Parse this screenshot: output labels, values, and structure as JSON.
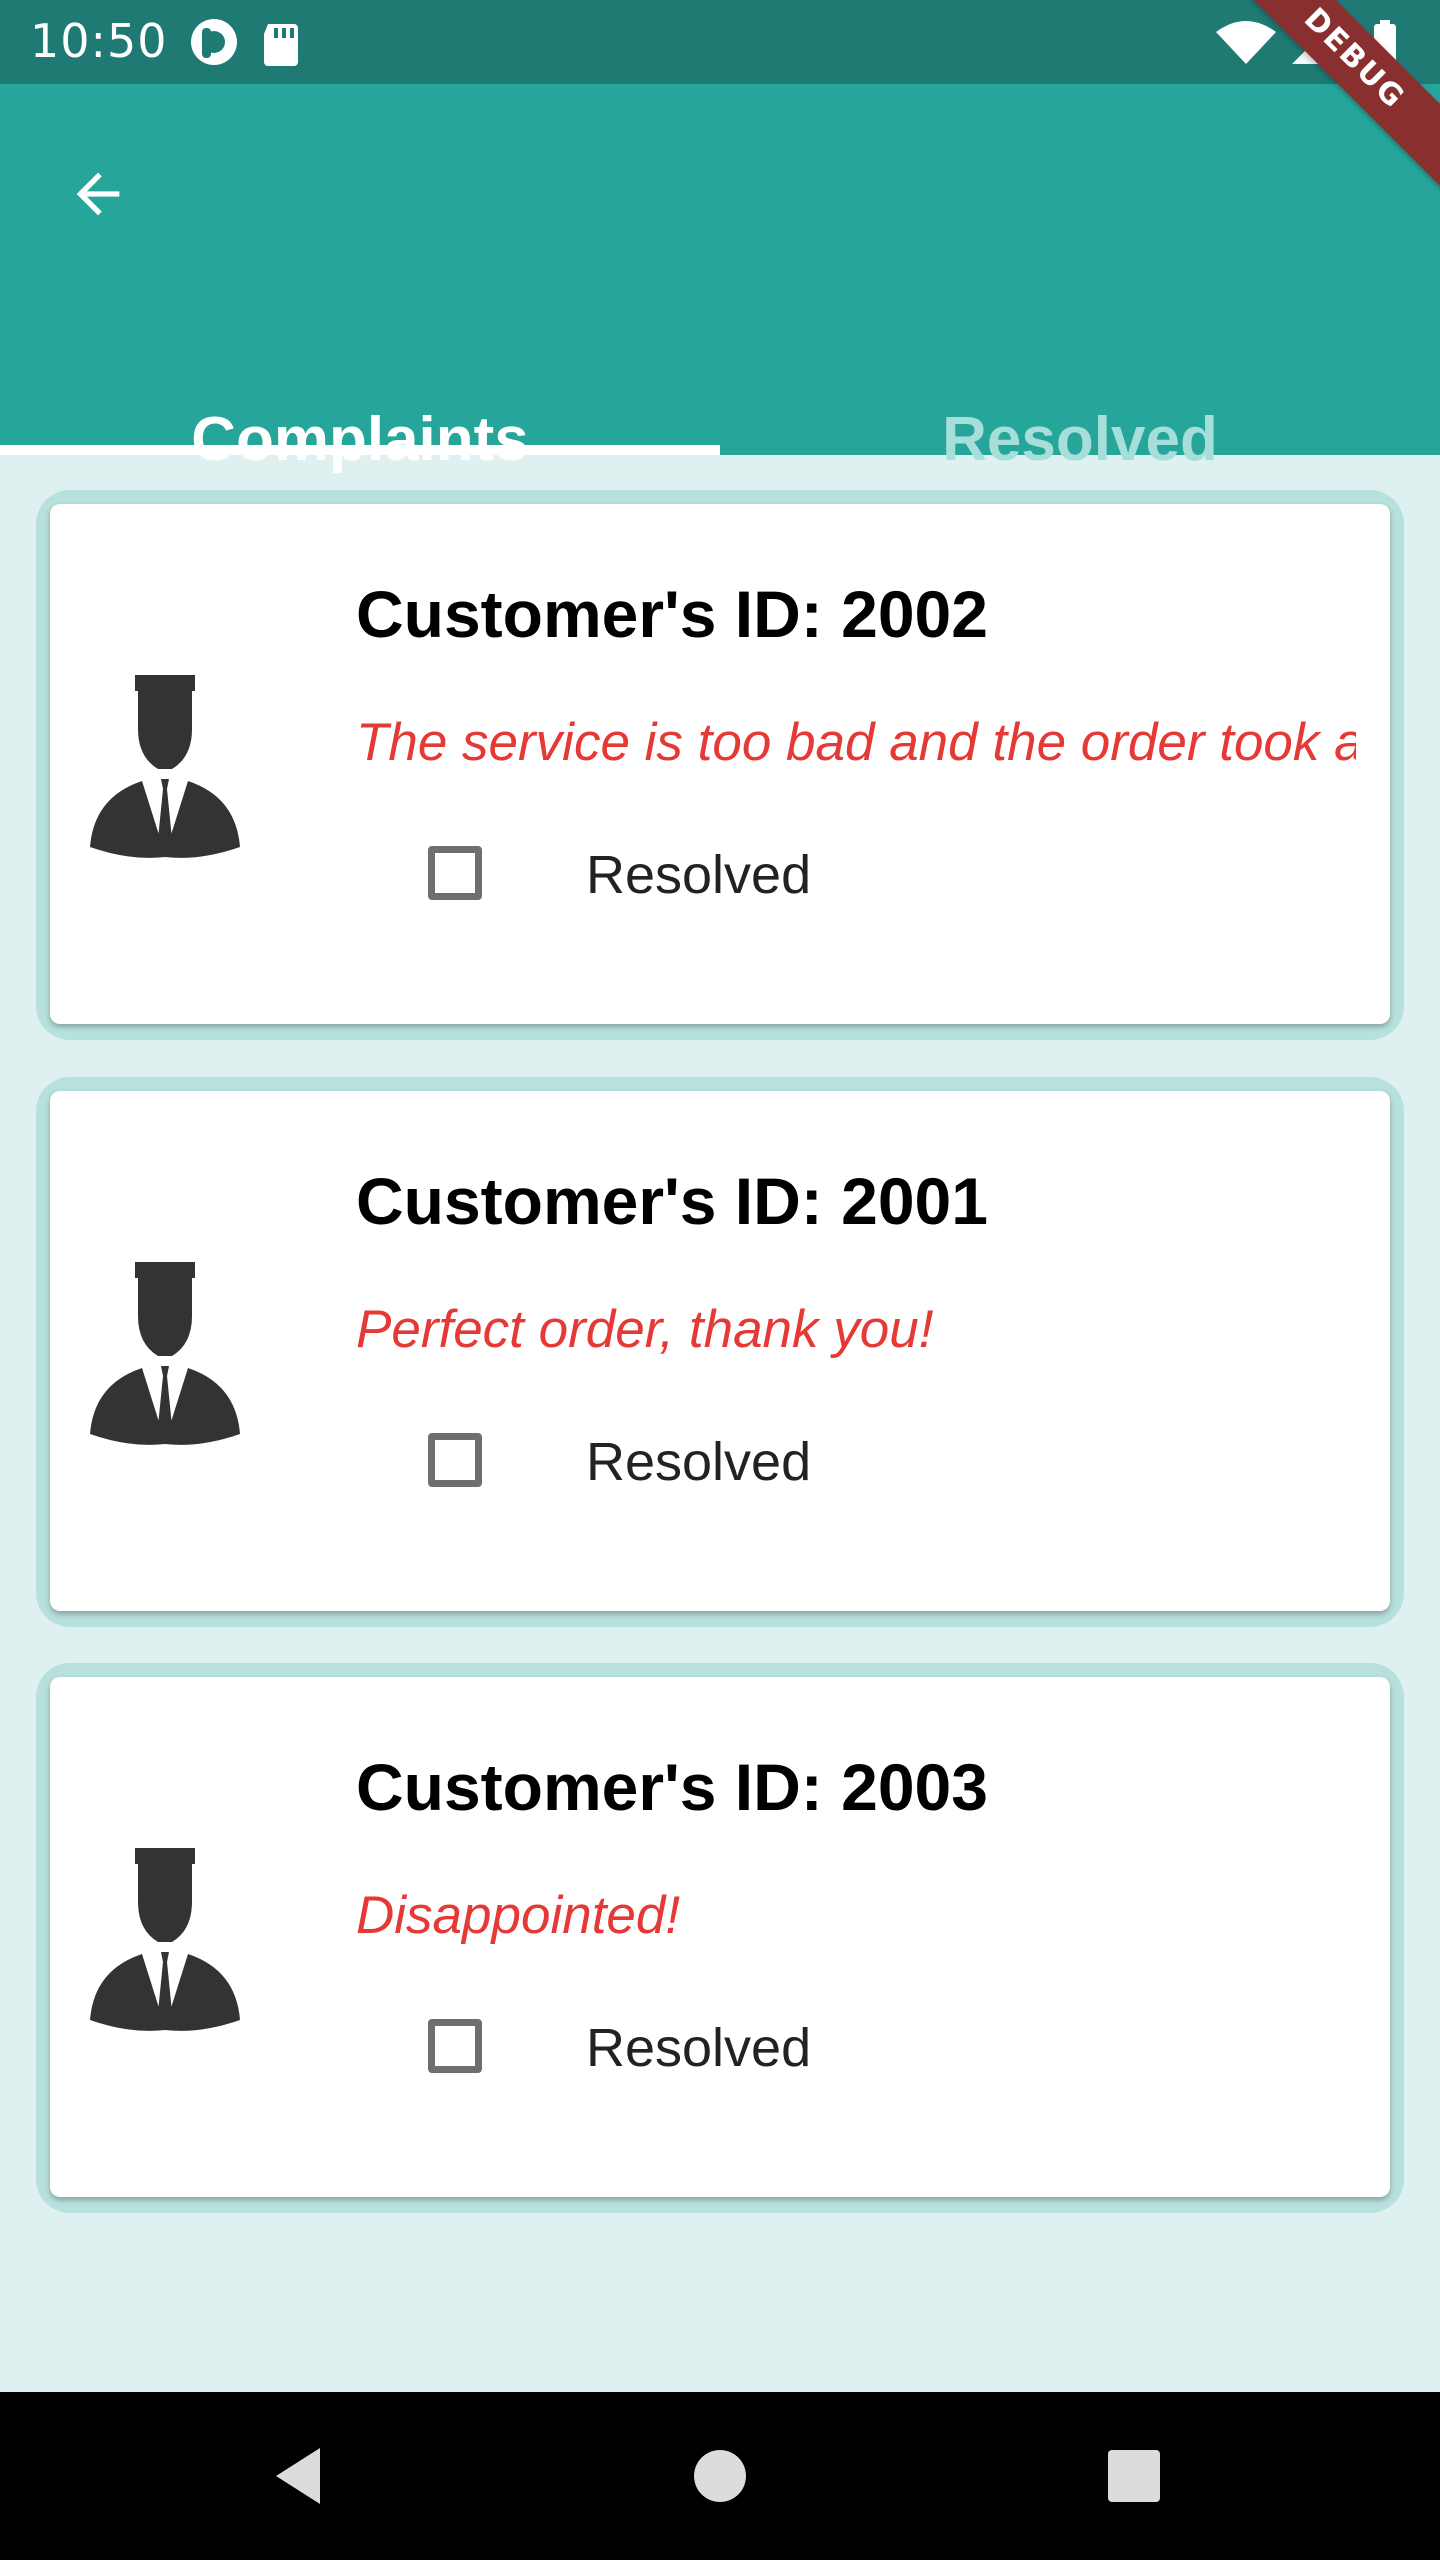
{
  "status_bar": {
    "time": "10:50",
    "icons": [
      "pocket-casts-icon",
      "sd-card-icon",
      "wifi-icon",
      "signal-icon",
      "battery-icon"
    ]
  },
  "debug_banner": {
    "label": "DEBUG"
  },
  "tabs": [
    {
      "label": "Complaints",
      "selected": true
    },
    {
      "label": "Resolved",
      "selected": false
    }
  ],
  "complaints": [
    {
      "customer_id": "Customer's ID: 2002",
      "message": "The service is too bad and the order took a",
      "checkbox_label": "Resolved",
      "checked": false
    },
    {
      "customer_id": "Customer's ID: 2001",
      "message": "Perfect order, thank you!",
      "checkbox_label": "Resolved",
      "checked": false
    },
    {
      "customer_id": "Customer's ID: 2003",
      "message": "Disappointed!",
      "checkbox_label": "Resolved",
      "checked": false
    }
  ],
  "colors": {
    "status_bar": "#1e7a73",
    "app_bar": "#26a69a",
    "tab_inactive_text": "#a6dfd9",
    "background": "#def0ef",
    "card_outline": "#b8e1dd",
    "message_text": "#e53935",
    "debug_banner": "#8a2f2f"
  },
  "nav_bar": {
    "icons": [
      "back-triangle-icon",
      "home-circle-icon",
      "recents-square-icon"
    ]
  }
}
